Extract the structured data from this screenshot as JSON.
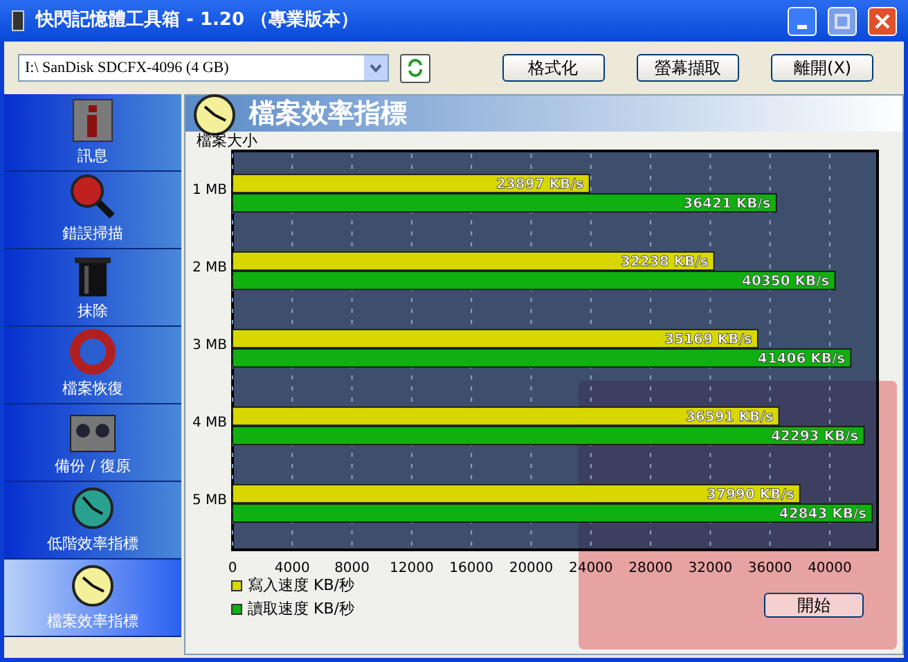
{
  "window": {
    "title": "快閃記憶體工具箱 - 1.20 （專業版本）"
  },
  "toolbar": {
    "device": "I:\\ SanDisk SDCFX-4096 (4 GB)",
    "buttons": [
      "格式化",
      "螢幕擷取",
      "離開(X)"
    ]
  },
  "sidebar": {
    "items": [
      {
        "label": "訊息",
        "kind": "info",
        "selected": false
      },
      {
        "label": "錯誤掃描",
        "kind": "scan",
        "selected": false
      },
      {
        "label": "抹除",
        "kind": "erase",
        "selected": false
      },
      {
        "label": "檔案恢復",
        "kind": "recover",
        "selected": false
      },
      {
        "label": "備份 / 復原",
        "kind": "backup",
        "selected": false
      },
      {
        "label": "低階效率指標",
        "kind": "lowbench",
        "selected": false
      },
      {
        "label": "檔案效率指標",
        "kind": "filebench",
        "selected": true
      }
    ]
  },
  "panel": {
    "title": "檔案效率指標",
    "chart_data": {
      "type": "bar",
      "orientation": "horizontal",
      "ylabel": "檔案大小",
      "categories": [
        "1 MB",
        "2 MB",
        "3 MB",
        "4 MB",
        "5 MB"
      ],
      "series": [
        {
          "name": "寫入速度 KB/秒",
          "color": "#d8d800",
          "values": [
            23897,
            32238,
            35169,
            36591,
            37990
          ],
          "value_labels": [
            "23897 KB/s",
            "32238 KB/s",
            "35169 KB/s",
            "36591 KB/s",
            "37990 KB/s"
          ]
        },
        {
          "name": "讀取速度 KB/秒",
          "color": "#10b010",
          "values": [
            36421,
            40350,
            41406,
            42293,
            42843
          ],
          "value_labels": [
            "36421 KB/s",
            "40350 KB/s",
            "41406 KB/s",
            "42293 KB/s",
            "42843 KB/s"
          ]
        }
      ],
      "xlim": [
        0,
        43200
      ],
      "grid": true,
      "xticks": [
        0,
        4000,
        8000,
        12000,
        16000,
        20000,
        24000,
        28000,
        32000,
        36000,
        40000
      ]
    },
    "start_button": "開始"
  }
}
